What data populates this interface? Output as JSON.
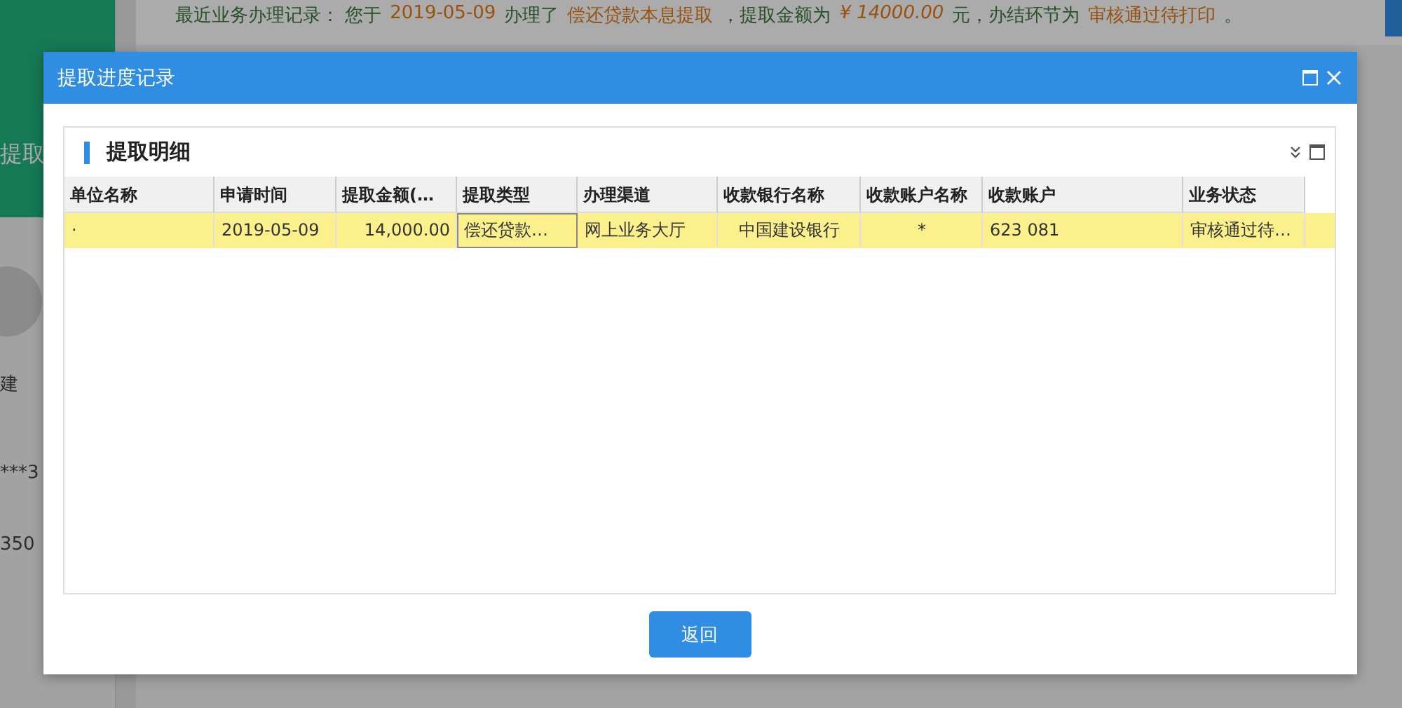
{
  "notice": [
    {
      "kind": "plain",
      "text": "最近业务办理记录：  您于"
    },
    {
      "kind": "highlight",
      "text": "2019-05-09"
    },
    {
      "kind": "plain",
      "text": "办理了"
    },
    {
      "kind": "highlight",
      "text": "偿还贷款本息提取"
    },
    {
      "kind": "plain",
      "text": "，提取金额为"
    },
    {
      "kind": "amount",
      "text": "¥ 14000.00"
    },
    {
      "kind": "plain",
      "text": "元，办结环节为"
    },
    {
      "kind": "highlight",
      "text": "审核通过待打印"
    },
    {
      "kind": "plain",
      "text": "。"
    }
  ],
  "sidebar": {
    "tile_label": "提取",
    "texts": [
      "建",
      "***3",
      "350"
    ]
  },
  "dialog": {
    "title": "提取进度记录",
    "panel_title": "提取明细",
    "columns": [
      {
        "label": "单位名称",
        "kind": "text"
      },
      {
        "label": "申请时间",
        "kind": "text"
      },
      {
        "label": "提取金额(…",
        "kind": "amount"
      },
      {
        "label": "提取类型",
        "kind": "text"
      },
      {
        "label": "办理渠道",
        "kind": "text"
      },
      {
        "label": "收款银行名称",
        "kind": "center"
      },
      {
        "label": "收款账户名称",
        "kind": "center"
      },
      {
        "label": "收款账户",
        "kind": "text"
      },
      {
        "label": "业务状态",
        "kind": "text"
      }
    ],
    "rows": [
      {
        "selected": true,
        "cells": [
          {
            "text": "·",
            "focused": false
          },
          {
            "text": "2019-05-09",
            "focused": false
          },
          {
            "text": "14,000.00",
            "focused": false
          },
          {
            "text": "偿还贷款…",
            "focused": true
          },
          {
            "text": "网上业务大厅",
            "focused": false
          },
          {
            "text": "中国建设银行",
            "focused": false
          },
          {
            "text": "*",
            "focused": false
          },
          {
            "text": "623    081",
            "focused": false
          },
          {
            "text": "审核通过待…",
            "focused": false
          }
        ]
      }
    ],
    "buttons": [
      "返回"
    ]
  }
}
